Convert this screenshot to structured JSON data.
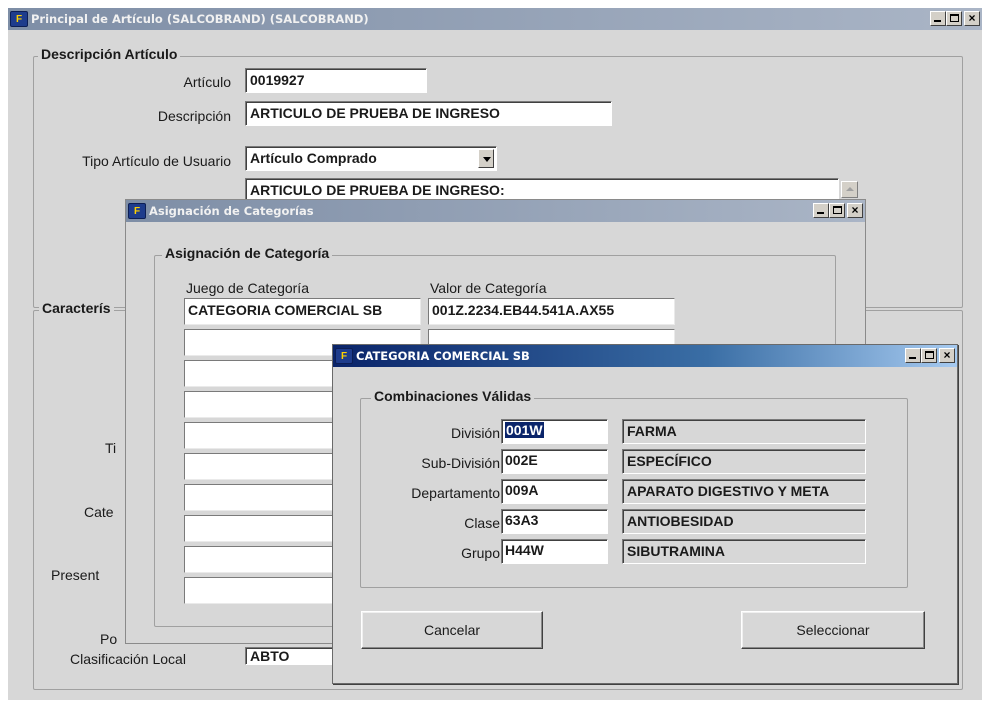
{
  "main_window": {
    "title": "Principal de Artículo (SALCOBRAND) (SALCOBRAND)",
    "group_descripcion": {
      "legend": "Descripción Artículo",
      "articulo_label": "Artículo",
      "articulo_value": "0019927",
      "descripcion_label": "Descripción",
      "descripcion_value": "ARTICULO DE PRUEBA DE INGRESO",
      "tipo_label": "Tipo Artículo de Usuario",
      "tipo_value": "Artículo Comprado",
      "nota_value": "ARTICULO DE PRUEBA DE INGRESO:"
    },
    "group_caracteristicas": {
      "legend": "Caracterís"
    },
    "partial_labels": {
      "ti": "Ti",
      "cate": "Cate",
      "present": "Present",
      "po": "Po",
      "clasificacion": "Clasificación Local",
      "clasificacion_value": "ABTO"
    }
  },
  "asignacion_window": {
    "title": "Asignación de Categorías",
    "group_legend": "Asignación de Categoría",
    "col_juego": "Juego de Categoría",
    "col_valor": "Valor de Categoría",
    "rows": [
      {
        "juego": "CATEGORIA COMERCIAL SB",
        "valor": "001Z.2234.EB44.541A.AX55"
      },
      {
        "juego": "",
        "valor": ""
      },
      {
        "juego": "",
        "valor": ""
      },
      {
        "juego": "",
        "valor": ""
      },
      {
        "juego": "",
        "valor": ""
      },
      {
        "juego": "",
        "valor": ""
      },
      {
        "juego": "",
        "valor": ""
      },
      {
        "juego": "",
        "valor": ""
      },
      {
        "juego": "",
        "valor": ""
      },
      {
        "juego": "",
        "valor": ""
      }
    ]
  },
  "categoria_window": {
    "title": "CATEGORIA COMERCIAL SB",
    "group_legend": "Combinaciones Válidas",
    "rows": [
      {
        "label": "División",
        "code": "001W",
        "desc": "FARMA"
      },
      {
        "label": "Sub-División",
        "code": "002E",
        "desc": "ESPECÍFICO"
      },
      {
        "label": "Departamento",
        "code": "009A",
        "desc": "APARATO DIGESTIVO Y META"
      },
      {
        "label": "Clase",
        "code": "63A3",
        "desc": "ANTIOBESIDAD"
      },
      {
        "label": "Grupo",
        "code": "H44W",
        "desc": "SIBUTRAMINA"
      }
    ],
    "cancel_label": "Cancelar",
    "select_label": "Seleccionar"
  },
  "icons": {
    "app_icon": "oracle-forms-app-icon",
    "minimize": "minimize-icon",
    "maximize": "maximize-icon",
    "close": "close-icon",
    "dropdown": "chevron-down-icon",
    "scroll_up": "scroll-up-arrow-icon"
  },
  "colors": {
    "active_title": "#0a246a",
    "inactive_title": "#7e8ea6",
    "form_background": "#d7d7d7",
    "selection": "#0a246a"
  }
}
